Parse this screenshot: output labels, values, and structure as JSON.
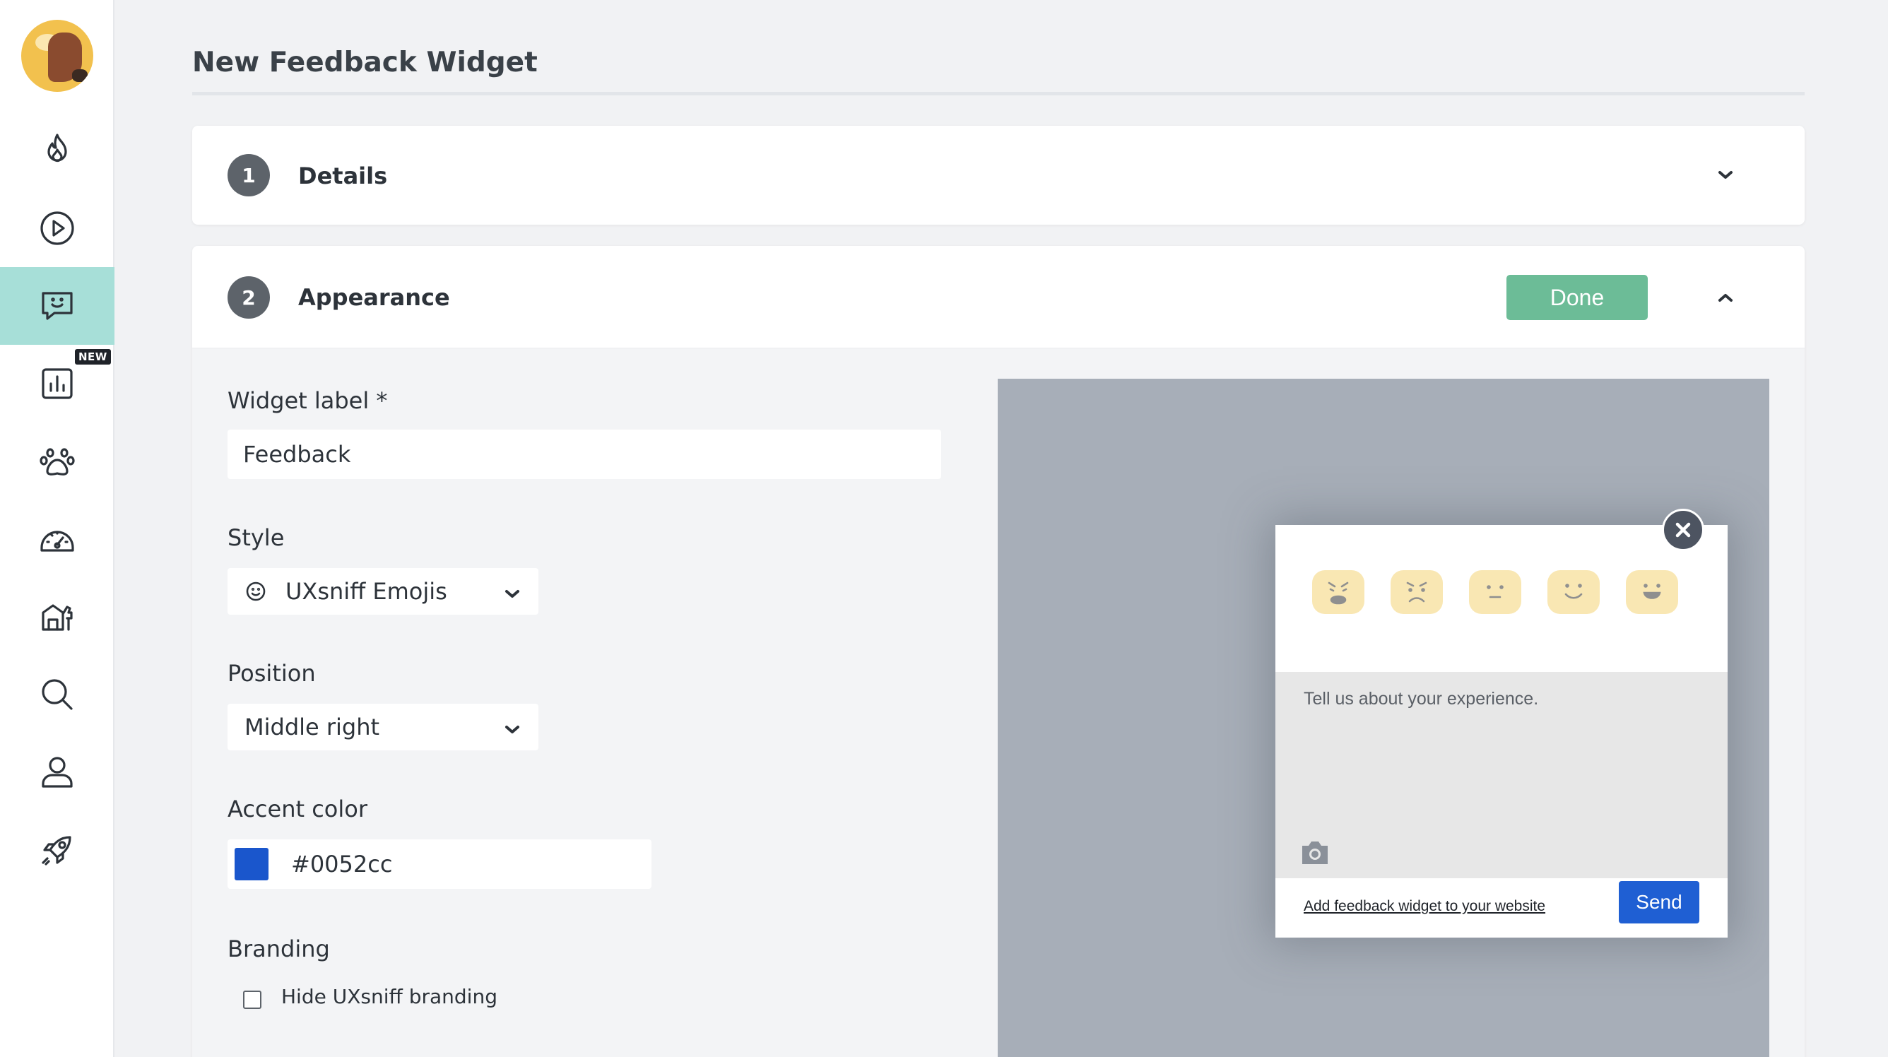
{
  "page": {
    "title": "New Feedback Widget"
  },
  "sidebar": {
    "items": [
      {
        "icon": "flame-icon",
        "name": "sidebar-item-heatmaps"
      },
      {
        "icon": "play-circle-icon",
        "name": "sidebar-item-recordings"
      },
      {
        "icon": "chat-smile-icon",
        "name": "sidebar-item-feedback",
        "active": true
      },
      {
        "icon": "bar-chart-icon",
        "name": "sidebar-item-reports",
        "badge": "NEW"
      },
      {
        "icon": "paw-icon",
        "name": "sidebar-item-pets"
      },
      {
        "icon": "gauge-icon",
        "name": "sidebar-item-dashboard"
      },
      {
        "icon": "dog-house-icon",
        "name": "sidebar-item-kennel"
      },
      {
        "icon": "search-icon",
        "name": "sidebar-item-search"
      },
      {
        "icon": "user-icon",
        "name": "sidebar-item-account"
      },
      {
        "icon": "rocket-icon",
        "name": "sidebar-item-launch"
      }
    ],
    "badge_new": "NEW"
  },
  "steps": {
    "details": {
      "number": "1",
      "label": "Details"
    },
    "appearance": {
      "number": "2",
      "label": "Appearance",
      "done_label": "Done"
    }
  },
  "form": {
    "widget_label": {
      "label": "Widget label *",
      "value": "Feedback"
    },
    "style": {
      "label": "Style",
      "value": "UXsniff Emojis"
    },
    "position": {
      "label": "Position",
      "value": "Middle right"
    },
    "accent_color": {
      "label": "Accent color",
      "value": "#0052cc",
      "swatch": "#1a56cc"
    },
    "branding": {
      "label": "Branding",
      "checkbox_label": "Hide UXsniff branding",
      "checked": false
    }
  },
  "preview": {
    "emojis": [
      "angry-emoji-icon",
      "sad-emoji-icon",
      "neutral-emoji-icon",
      "happy-emoji-icon",
      "very-happy-emoji-icon"
    ],
    "placeholder": "Tell us about your experience.",
    "link_text": "Add feedback widget to your website",
    "send_label": "Send"
  },
  "colors": {
    "active_nav": "#a7dfd8",
    "done_button": "#6cbc97",
    "send_button": "#1f5fd3",
    "step_circle": "#5d636a"
  }
}
